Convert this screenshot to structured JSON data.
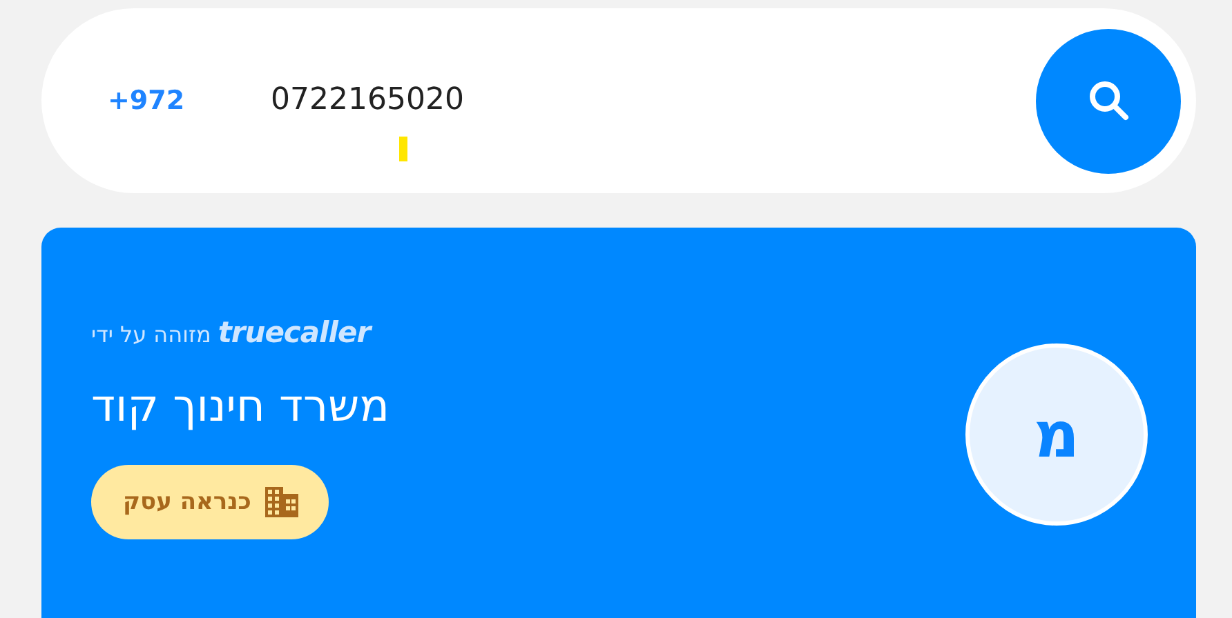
{
  "search": {
    "country_code": "+972",
    "value": "0722165020"
  },
  "result": {
    "identified_by": "מזוהה על ידי",
    "brand": "truecaller",
    "name": "משרד חינוך קוד",
    "tag": "כנראה עסק",
    "avatar_letter": "מ"
  }
}
